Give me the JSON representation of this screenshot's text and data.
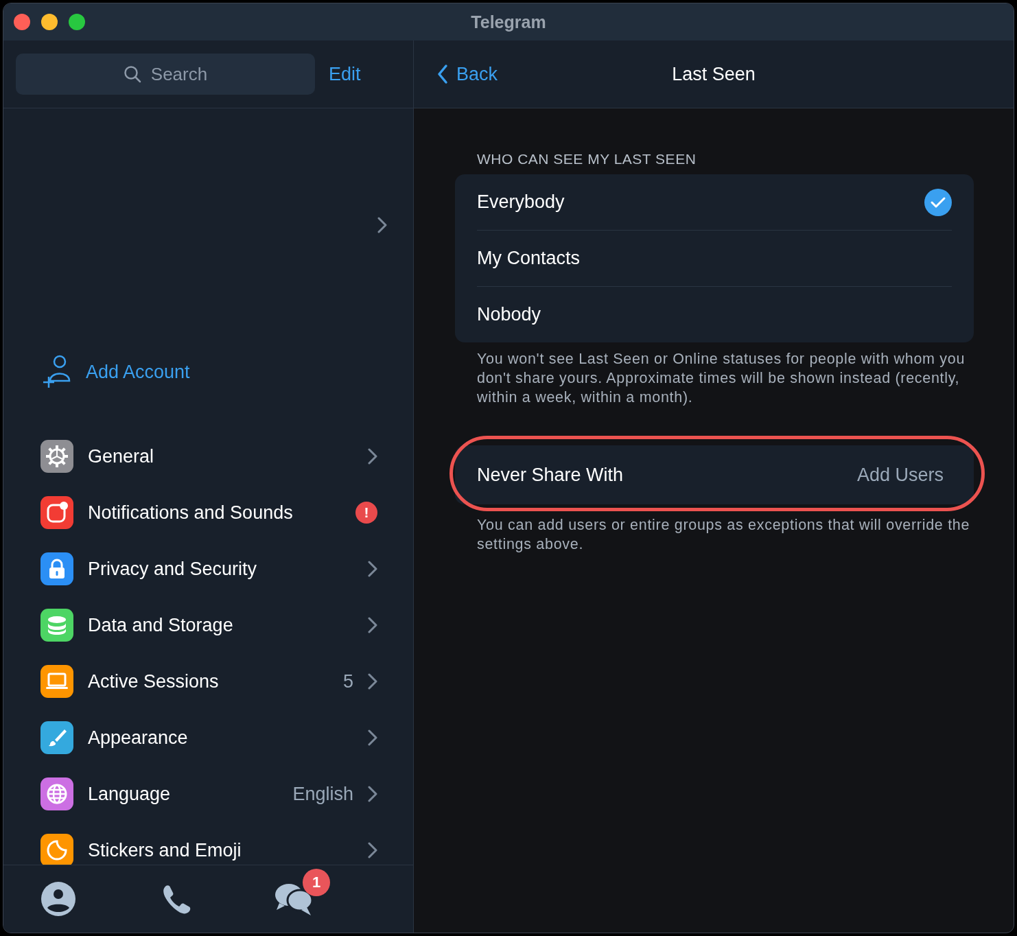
{
  "window": {
    "title": "Telegram"
  },
  "sidebar": {
    "search": {
      "placeholder": "Search"
    },
    "edit": "Edit",
    "add_account": "Add Account",
    "items": [
      {
        "label": "General",
        "color": "#8e8e93"
      },
      {
        "label": "Notifications and Sounds",
        "color": "#f23c34",
        "badge": "!"
      },
      {
        "label": "Privacy and Security",
        "color": "#2b8ff5"
      },
      {
        "label": "Data and Storage",
        "color": "#4dd564"
      },
      {
        "label": "Active Sessions",
        "color": "#fe9500",
        "value": "5"
      },
      {
        "label": "Appearance",
        "color": "#34a9de"
      },
      {
        "label": "Language",
        "color": "#cc6fe3",
        "value": "English"
      },
      {
        "label": "Stickers and Emoji",
        "color": "#fe9500"
      }
    ],
    "tabs": [
      {
        "selected": false
      },
      {
        "selected": false
      },
      {
        "selected": false,
        "badge": "1"
      }
    ]
  },
  "header": {
    "back": "Back",
    "title": "Last Seen"
  },
  "section_label": "WHO CAN SEE MY LAST SEEN",
  "options": [
    {
      "label": "Everybody",
      "selected": true
    },
    {
      "label": "My Contacts",
      "selected": false
    },
    {
      "label": "Nobody",
      "selected": false
    }
  ],
  "options_note": "You won't see Last Seen or Online statuses for people with whom you don't share yours. Approximate times will be shown instead (recently, within a week, within a month).",
  "exceptions": {
    "label": "Never Share With",
    "action": "Add Users",
    "highlighted": true
  },
  "exceptions_note": "You can add users or entire groups as exceptions that will override the settings above."
}
